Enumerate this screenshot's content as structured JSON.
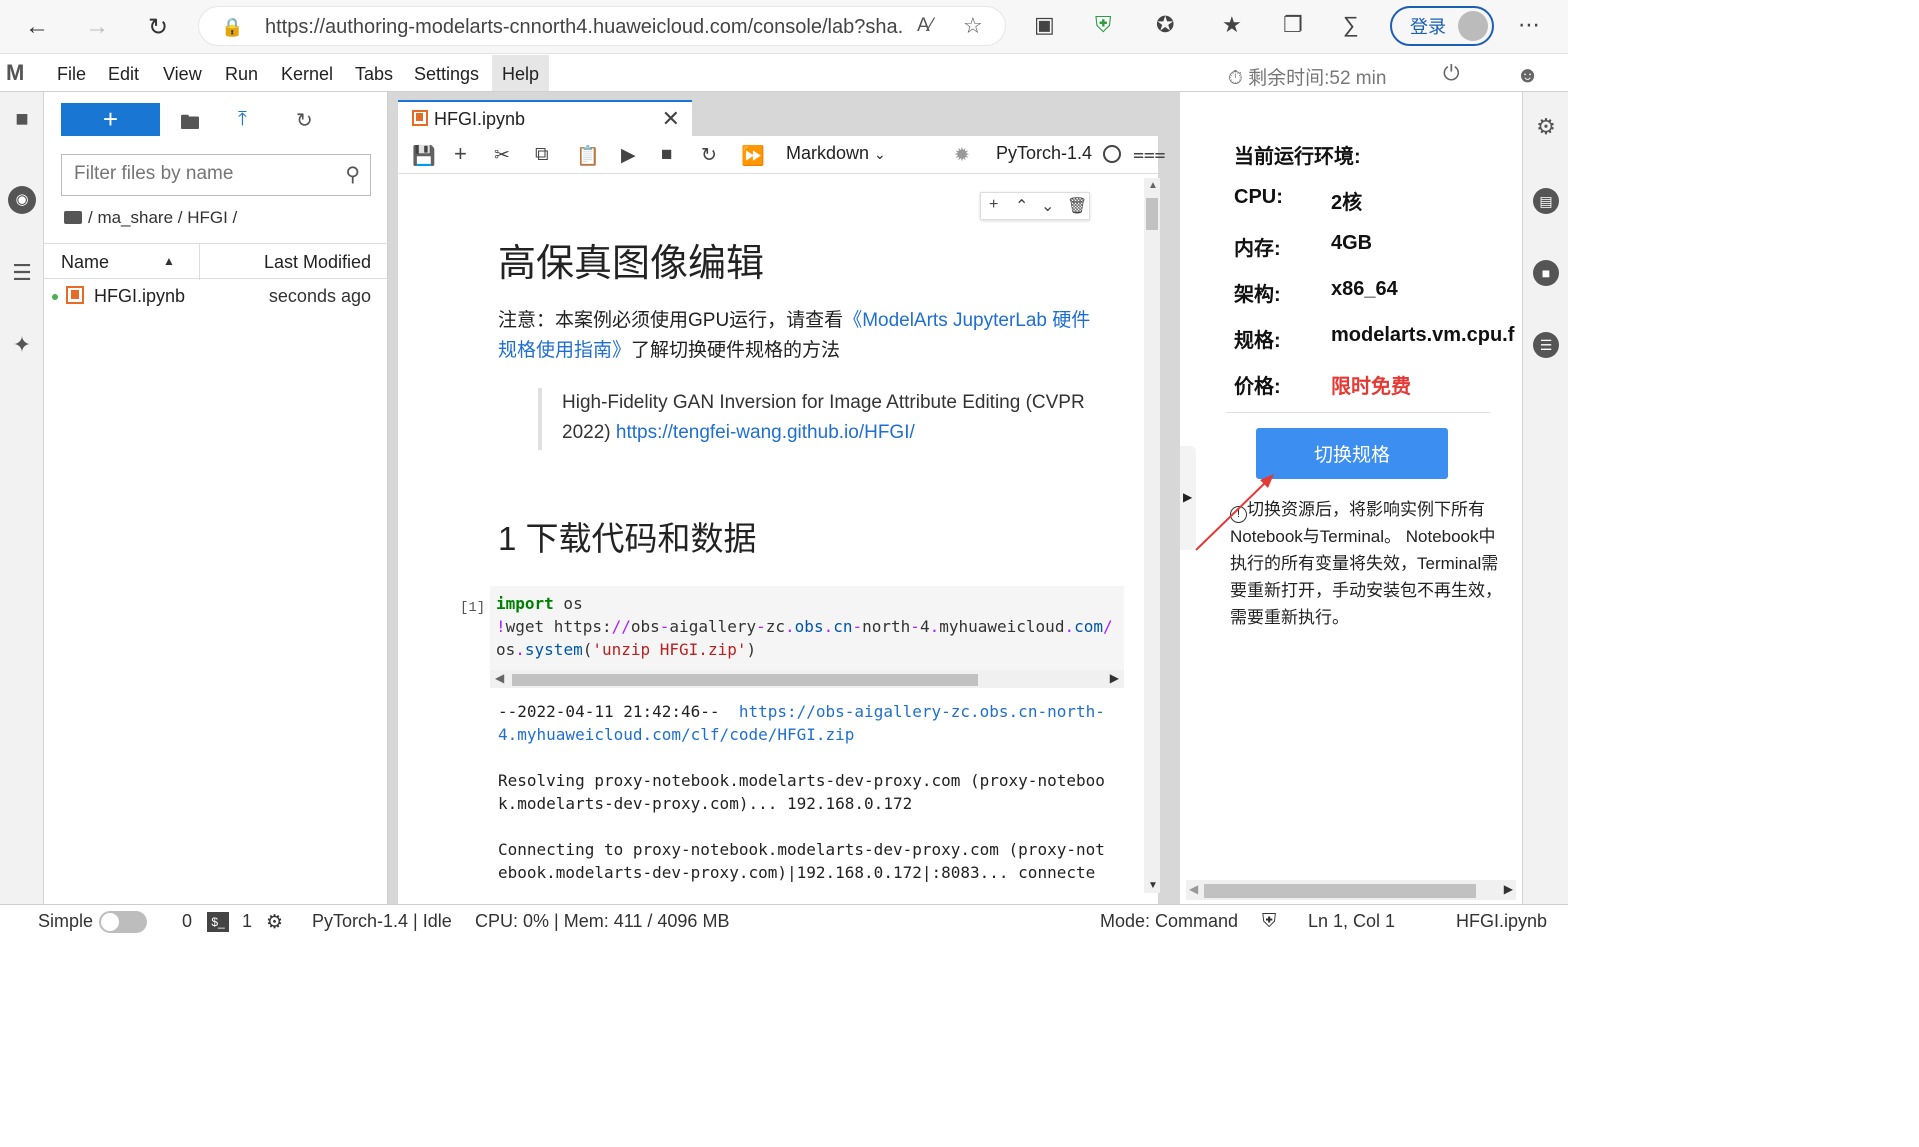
{
  "browser": {
    "url": "https://authoring-modelarts-cnnorth4.huaweicloud.com/console/lab?sha...",
    "login_label": "登录"
  },
  "menu": {
    "items": [
      "File",
      "Edit",
      "View",
      "Run",
      "Kernel",
      "Tabs",
      "Settings",
      "Help"
    ],
    "timer": "剩余时间:52 min"
  },
  "filebrowser": {
    "filter_placeholder": "Filter files by name",
    "breadcrumb": "/ ma_share / HFGI /",
    "col_name": "Name",
    "col_modified": "Last Modified",
    "files": [
      {
        "name": "HFGI.ipynb",
        "modified": "seconds ago"
      }
    ]
  },
  "notebook": {
    "tab_label": "HFGI.ipynb",
    "cell_type": "Markdown",
    "kernel": "PyTorch-1.4",
    "heading1": "高保真图像编辑",
    "note_prefix": "注意：本案例必须使用GPU运行，请查看",
    "note_link": "《ModelArts JupyterLab 硬件规格使用指南》",
    "note_suffix": "了解切换硬件规格的方法",
    "quote_text": "High-Fidelity GAN Inversion for Image Attribute Editing (CVPR 2022)",
    "quote_link": "https://tengfei-wang.github.io/HFGI/",
    "heading2": "1 下载代码和数据",
    "cell_prompt": "[1]",
    "output_line1_prefix": "--2022-04-11 21:42:46--  ",
    "output_line1_link": "https://obs-aigallery-zc.obs.cn-north-\n4.myhuaweicloud.com/clf/code/HFGI.zip",
    "output_block2": "Resolving proxy-notebook.modelarts-dev-proxy.com (proxy-noteboo\nk.modelarts-dev-proxy.com)... 192.168.0.172",
    "output_block3": "Connecting to proxy-notebook.modelarts-dev-proxy.com (proxy-not\nebook.modelarts-dev-proxy.com)|192.168.0.172|:8083... connecte"
  },
  "env_panel": {
    "title": "当前运行环境:",
    "rows": [
      {
        "label": "CPU:",
        "value": "2核"
      },
      {
        "label": "内存:",
        "value": "4GB"
      },
      {
        "label": "架构:",
        "value": "x86_64"
      },
      {
        "label": "规格:",
        "value": "modelarts.vm.cpu.f"
      },
      {
        "label": "价格:",
        "value": "限时免费"
      }
    ],
    "switch_button": "切换规格",
    "warning": "切换资源后，将影响实例下所有Notebook与Terminal。 Notebook中执行的所有变量将失效，Terminal需要重新打开，手动安装包不再生效，需要重新执行。",
    "price_color": "#e53935",
    "button_color": "#3c8ff0"
  },
  "statusbar": {
    "mode_label": "Simple",
    "count_kernels": "0",
    "count_terminals": "1",
    "kernel_status": "PyTorch-1.4 | Idle",
    "resources": "CPU: 0% | Mem: 411 / 4096 MB",
    "mode": "Mode: Command",
    "position": "Ln 1, Col 1",
    "file": "HFGI.ipynb"
  }
}
